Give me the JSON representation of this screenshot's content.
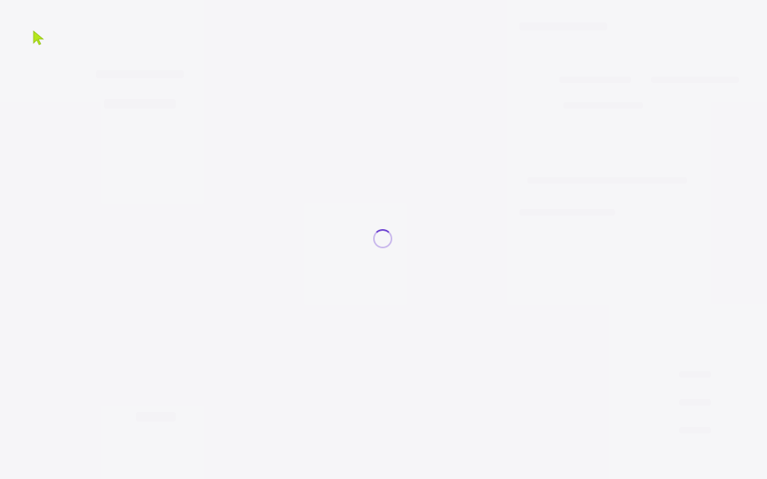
{
  "page": {
    "state": "loading"
  },
  "spinner": {
    "icon": "loading-spinner-icon",
    "track_color": "#c9b8ec",
    "arc_color": "#6a3fd1"
  },
  "cursor": {
    "icon": "mouse-pointer-icon",
    "color": "#b5e61d"
  },
  "background": {
    "color": "#f6f5f8"
  }
}
